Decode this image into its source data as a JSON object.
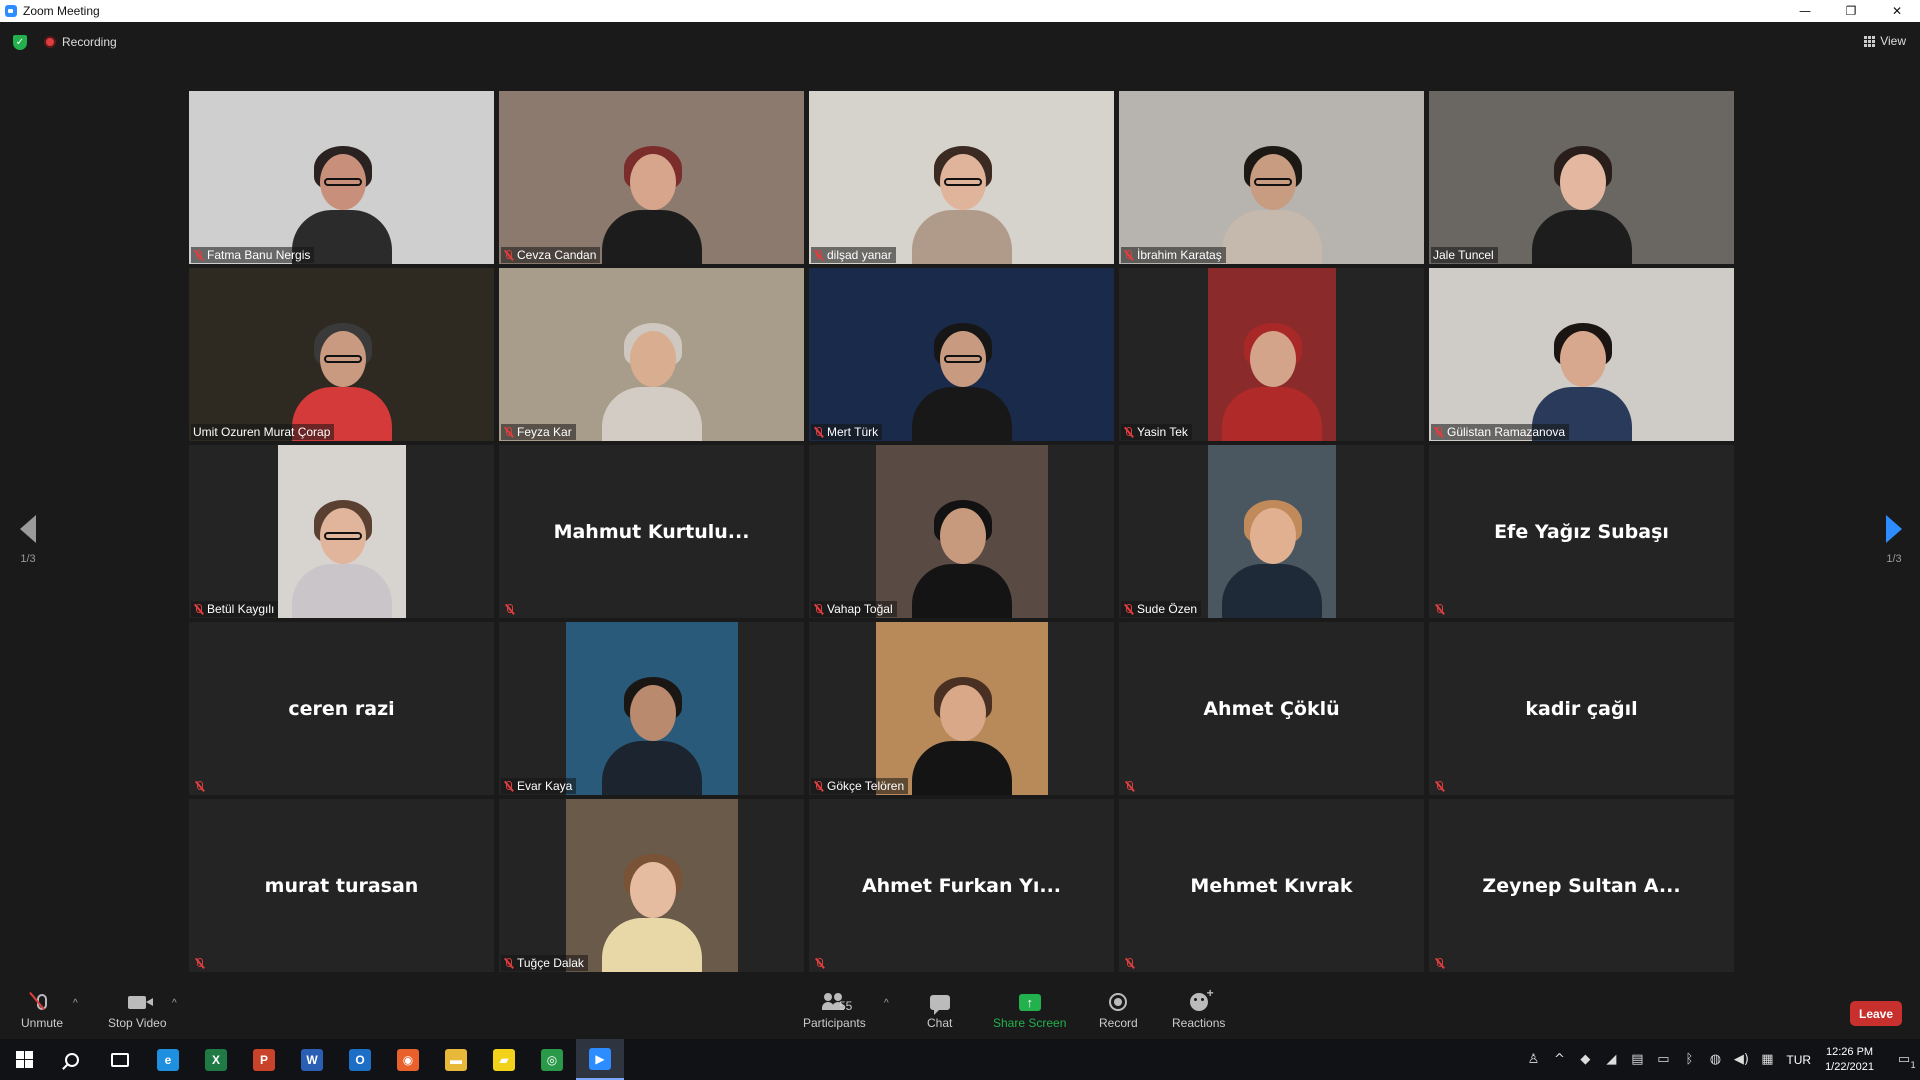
{
  "window": {
    "title": "Zoom Meeting",
    "minimize_glyph": "—",
    "restore_glyph": "❐",
    "close_glyph": "✕"
  },
  "header": {
    "recording_label": "Recording",
    "view_label": "View",
    "security_icon": "shield-check-icon"
  },
  "pagination": {
    "left": "1/3",
    "right": "1/3"
  },
  "tiles": [
    {
      "name": "Fatma Banu Nergis",
      "muted": true,
      "video": true,
      "bg": "#cfcfcf",
      "skin": "#c8907a",
      "hair": "#2a2220",
      "shirt": "#2b2b2b",
      "glasses": true,
      "active": false
    },
    {
      "name": "Cevza Candan",
      "muted": true,
      "video": true,
      "bg": "#8c7a6e",
      "skin": "#d7a58c",
      "hair": "#7a2d2a",
      "shirt": "#1c1c1c",
      "glasses": false,
      "active": false
    },
    {
      "name": "dilşad yanar",
      "muted": true,
      "video": true,
      "bg": "#d6d2cc",
      "skin": "#e0b49a",
      "hair": "#3a2a22",
      "shirt": "#b09a8a",
      "glasses": true,
      "active": false
    },
    {
      "name": "İbrahim Karataş",
      "muted": true,
      "video": true,
      "bg": "#b7b3ae",
      "skin": "#c79c80",
      "hair": "#1c1814",
      "shirt": "#c4b9ac",
      "glasses": true,
      "active": false
    },
    {
      "name": "Jale Tuncel",
      "muted": false,
      "video": true,
      "bg": "#6a6762",
      "skin": "#e4b8a0",
      "hair": "#2a1e1a",
      "shirt": "#1d1d1d",
      "glasses": false,
      "active": true
    },
    {
      "name": "Umit Ozuren Murat Çorap",
      "muted": false,
      "video": true,
      "bg": "#2e2a22",
      "skin": "#c99a80",
      "hair": "#3a3a3a",
      "shirt": "#d43a3a",
      "glasses": true,
      "active": false
    },
    {
      "name": "Feyza Kar",
      "muted": true,
      "video": true,
      "bg": "#a89c8a",
      "skin": "#d9ad8f",
      "hair": "#cfc8c0",
      "shirt": "#d3ccc4",
      "glasses": false,
      "active": false
    },
    {
      "name": "Mert Türk",
      "muted": true,
      "video": true,
      "bg": "#1a2a4a",
      "skin": "#c89a80",
      "hair": "#161616",
      "shirt": "#181818",
      "glasses": true,
      "active": false
    },
    {
      "name": "Yasin Tek",
      "muted": true,
      "video": true,
      "bg": "#8a2a2a",
      "skin": "#d3a38a",
      "hair": "#a82828",
      "shirt": "#b02a2a",
      "glasses": false,
      "active": false,
      "narrow": true
    },
    {
      "name": "Gülistan Ramazanova",
      "muted": true,
      "video": true,
      "bg": "#cfcbc6",
      "skin": "#d8a88e",
      "hair": "#1a1412",
      "shirt": "#2a3a5a",
      "glasses": false,
      "active": false
    },
    {
      "name": "Betül Kaygılı",
      "muted": true,
      "video": true,
      "bg": "#d7d3cf",
      "skin": "#e1b59c",
      "hair": "#5a4030",
      "shirt": "#c9c5c8",
      "glasses": true,
      "active": false,
      "narrow": true
    },
    {
      "name": "Mahmut Kurtulu...",
      "muted": true,
      "video": false
    },
    {
      "name": "Vahap Toğal",
      "muted": true,
      "video": true,
      "bg": "#5a4a44",
      "skin": "#c79a7e",
      "hair": "#121212",
      "shirt": "#141414",
      "glasses": false,
      "active": false
    },
    {
      "name": "Sude Özen",
      "muted": true,
      "video": true,
      "bg": "#4a5660",
      "skin": "#e0b090",
      "hair": "#c08a5a",
      "shirt": "#1e2a38",
      "glasses": false,
      "active": false,
      "narrow": true
    },
    {
      "name": "Efe Yağız Subaşı",
      "muted": true,
      "video": false
    },
    {
      "name": "ceren razi",
      "muted": true,
      "video": false
    },
    {
      "name": "Evar Kaya",
      "muted": true,
      "video": true,
      "bg": "#2a5a7a",
      "skin": "#b98a6e",
      "hair": "#1a1614",
      "shirt": "#1c2430",
      "glasses": false,
      "active": false
    },
    {
      "name": "Gökçe Telören",
      "muted": true,
      "video": true,
      "bg": "#b88a5a",
      "skin": "#d8a888",
      "hair": "#4a3022",
      "shirt": "#141414",
      "glasses": false,
      "active": false
    },
    {
      "name": "Ahmet Çöklü",
      "muted": true,
      "video": false
    },
    {
      "name": "kadir çağıl",
      "muted": true,
      "video": false
    },
    {
      "name": "murat turasan",
      "muted": true,
      "video": false
    },
    {
      "name": "Tuğçe Dalak",
      "muted": true,
      "video": true,
      "bg": "#6a5a4a",
      "skin": "#e6bca0",
      "hair": "#7a5236",
      "shirt": "#e8d8a8",
      "glasses": false,
      "active": false
    },
    {
      "name": "Ahmet Furkan Yı...",
      "muted": true,
      "video": false
    },
    {
      "name": "Mehmet Kıvrak",
      "muted": true,
      "video": false
    },
    {
      "name": "Zeynep Sultan A...",
      "muted": true,
      "video": false
    }
  ],
  "toolbar": {
    "unmute_label": "Unmute",
    "stop_video_label": "Stop Video",
    "participants_label": "Participants",
    "participants_count": "55",
    "chat_label": "Chat",
    "share_label": "Share Screen",
    "record_label": "Record",
    "reactions_label": "Reactions",
    "leave_label": "Leave",
    "caret_glyph": "^",
    "share_glyph": "↑"
  },
  "taskbar": {
    "apps": [
      {
        "name": "windows-start-icon",
        "kind": "win"
      },
      {
        "name": "search-icon",
        "kind": "search"
      },
      {
        "name": "task-view-icon",
        "kind": "taskview"
      },
      {
        "name": "edge-icon",
        "kind": "app",
        "color": "#1f8fe0",
        "glyph": "e"
      },
      {
        "name": "excel-icon",
        "kind": "app",
        "color": "#1f7a45",
        "glyph": "X"
      },
      {
        "name": "powerpoint-icon",
        "kind": "app",
        "color": "#c8432a",
        "glyph": "P"
      },
      {
        "name": "word-icon",
        "kind": "app",
        "color": "#2b5fb4",
        "glyph": "W"
      },
      {
        "name": "outlook-icon",
        "kind": "app",
        "color": "#1c6fc4",
        "glyph": "O"
      },
      {
        "name": "firefox-icon",
        "kind": "app",
        "color": "#e8612c",
        "glyph": "◉"
      },
      {
        "name": "file-explorer-icon",
        "kind": "app",
        "color": "#e8b83a",
        "glyph": "▬"
      },
      {
        "name": "sticky-notes-icon",
        "kind": "app",
        "color": "#f2d21b",
        "glyph": "▰"
      },
      {
        "name": "chrome-icon",
        "kind": "app",
        "color": "#2a9a4a",
        "glyph": "◎"
      },
      {
        "name": "zoom-taskbar-icon",
        "kind": "app",
        "color": "#2d8cff",
        "glyph": "▶",
        "active": true
      }
    ],
    "tray": [
      {
        "name": "people-icon",
        "glyph": "♙"
      },
      {
        "name": "show-hidden-icons",
        "glyph": "^"
      },
      {
        "name": "dropbox-icon",
        "glyph": "◆"
      },
      {
        "name": "network-icon",
        "glyph": "◢"
      },
      {
        "name": "printer-icon",
        "glyph": "▤"
      },
      {
        "name": "drive-icon",
        "glyph": "▭"
      },
      {
        "name": "bluetooth-icon",
        "glyph": "ᛒ"
      },
      {
        "name": "sync-icon",
        "glyph": "◍"
      },
      {
        "name": "volume-icon",
        "glyph": "◀)"
      },
      {
        "name": "keyboard-icon",
        "glyph": "▦"
      }
    ],
    "language": "TUR",
    "time": "12:26 PM",
    "date": "1/22/2021",
    "notification_glyph": "▭",
    "notification_count": "1"
  }
}
